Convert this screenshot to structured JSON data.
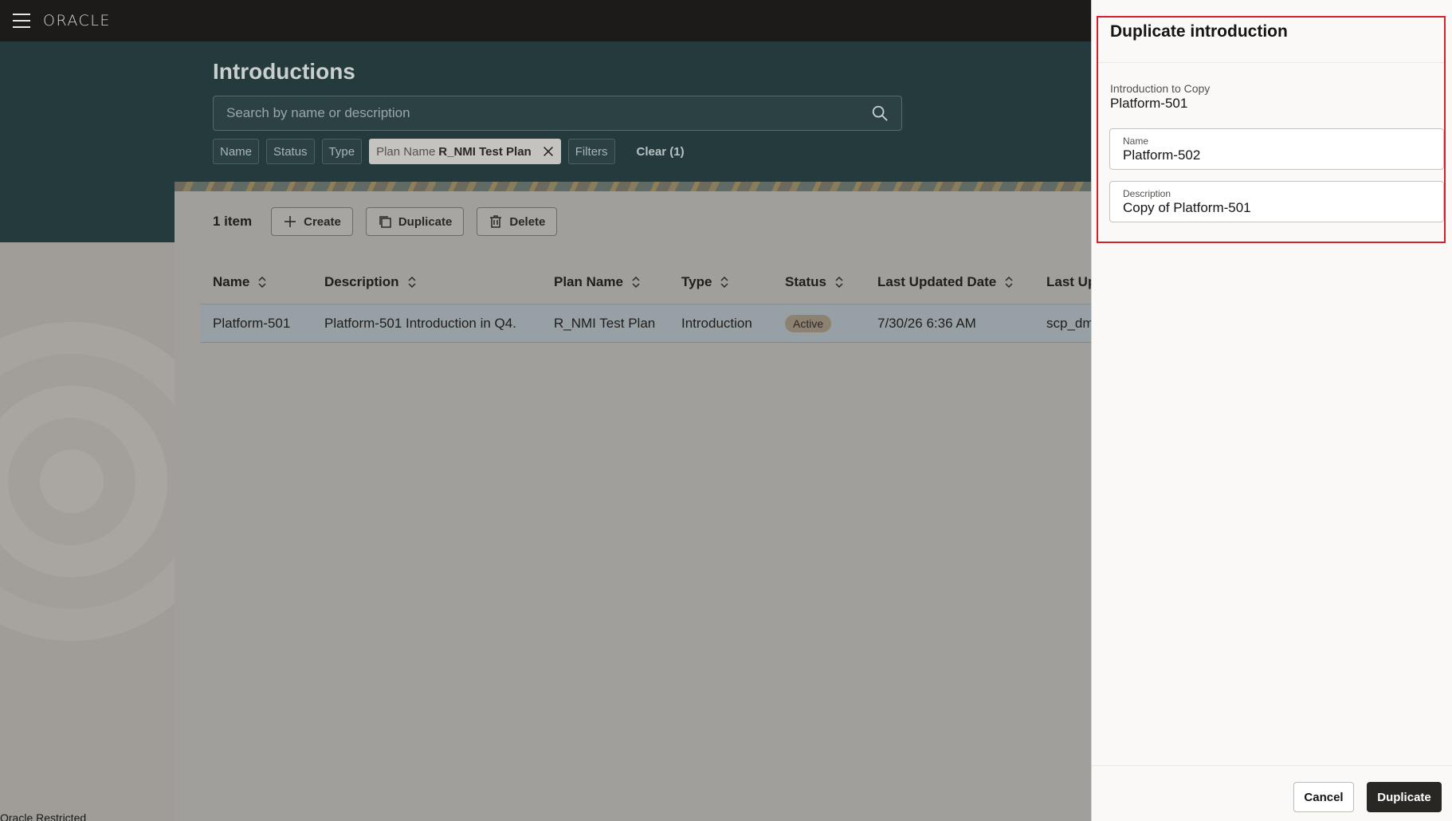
{
  "header": {
    "brand": "ORACLE"
  },
  "page": {
    "title": "Introductions"
  },
  "search": {
    "placeholder": "Search by name or description"
  },
  "filters": {
    "chips": [
      "Name",
      "Status",
      "Type"
    ],
    "active_chip": {
      "label": "Plan Name",
      "value": "R_NMI Test Plan"
    },
    "filters_label": "Filters",
    "clear_label": "Clear (1)"
  },
  "toolbar": {
    "count": "1 item",
    "create_label": "Create",
    "duplicate_label": "Duplicate",
    "delete_label": "Delete"
  },
  "table": {
    "columns": [
      "Name",
      "Description",
      "Plan Name",
      "Type",
      "Status",
      "Last Updated Date",
      "Last Up"
    ],
    "rows": [
      {
        "name": "Platform-501",
        "description": "Platform-501 Introduction in Q4.",
        "plan_name": "R_NMI Test Plan",
        "type": "Introduction",
        "status": "Active",
        "last_updated_date": "7/30/26 6:36 AM",
        "last_updated_by": "scp_dm"
      }
    ]
  },
  "drawer": {
    "title": "Duplicate introduction",
    "copy_label": "Introduction to Copy",
    "copy_value": "Platform-501",
    "name_label": "Name",
    "name_value": "Platform-502",
    "description_label": "Description",
    "description_value": "Copy of Platform-501",
    "cancel_label": "Cancel",
    "duplicate_label": "Duplicate"
  },
  "footer": {
    "text": "Oracle Restricted"
  },
  "colors": {
    "highlight": "#d81e28",
    "primary_button": "#292723",
    "band": "#253a3d"
  }
}
